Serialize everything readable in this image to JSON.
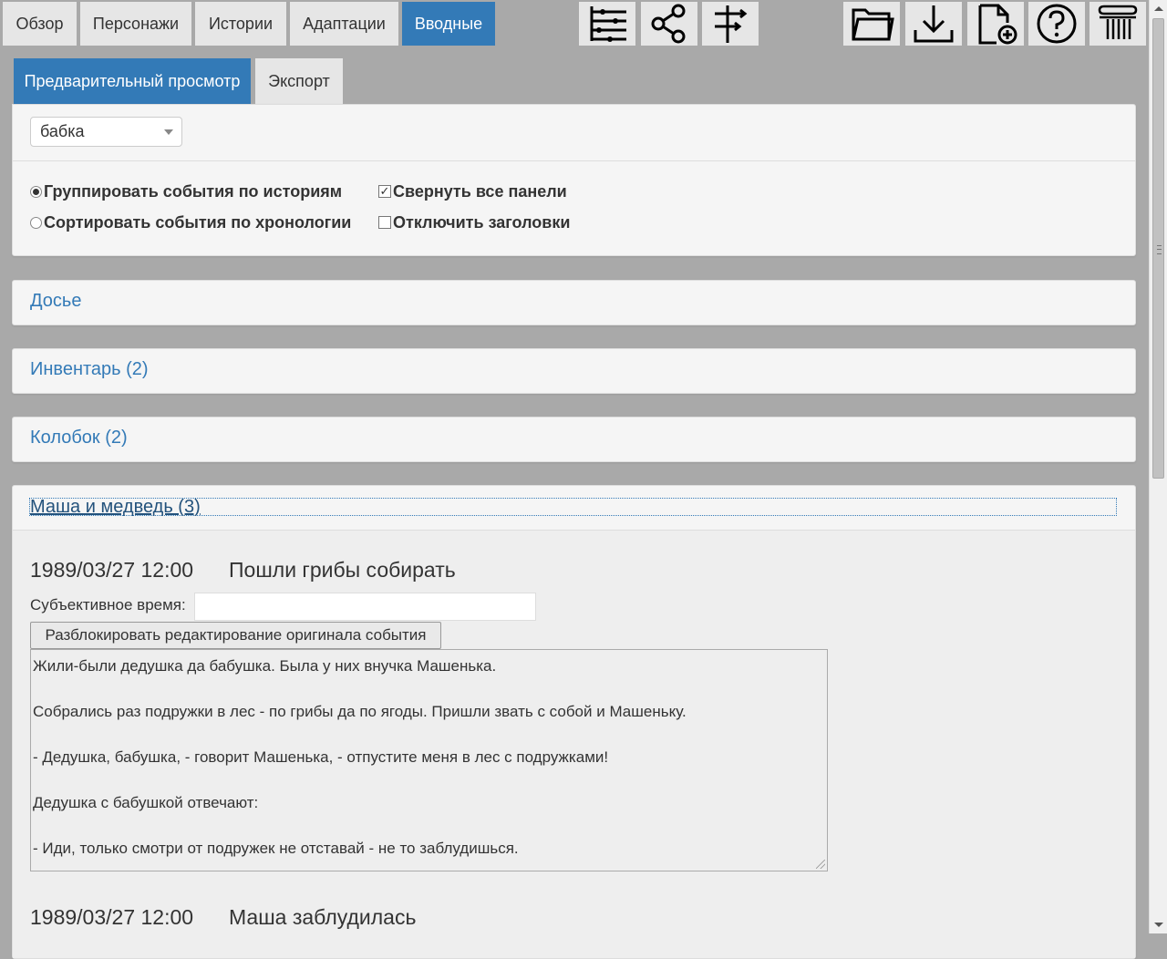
{
  "nav": {
    "tabs": [
      {
        "label": "Обзор",
        "active": false
      },
      {
        "label": "Персонажи",
        "active": false
      },
      {
        "label": "Истории",
        "active": false
      },
      {
        "label": "Адаптации",
        "active": false
      },
      {
        "label": "Вводные",
        "active": true
      }
    ],
    "tool_icons": [
      "timeline-icon",
      "network-icon",
      "signpost-icon"
    ],
    "action_icons": [
      "open-folder-icon",
      "download-icon",
      "new-file-icon",
      "help-icon",
      "column-icon"
    ]
  },
  "subtabs": [
    {
      "label": "Предварительный просмотр",
      "active": true
    },
    {
      "label": "Экспорт",
      "active": false
    }
  ],
  "settings": {
    "character_select": "бабка",
    "group_by_story": "Группировать события по историям",
    "sort_chronology": "Сортировать события по хронологии",
    "collapse_all": "Свернуть все панели",
    "disable_headers": "Отключить заголовки",
    "group_by_story_checked": true,
    "collapse_all_checked": true,
    "disable_headers_checked": false
  },
  "panels": {
    "dossier": "Досье",
    "inventory": "Инвентарь (2)",
    "kolobok": "Колобок (2)",
    "masha": "Маша и медведь (3)"
  },
  "events": [
    {
      "date": "1989/03/27 12:00",
      "title": "Пошли грибы собирать",
      "subjective_label": "Субъективное время:",
      "subjective_value": "",
      "unlock_label": "Разблокировать редактирование оригинала события",
      "text": [
        "Жили-были дедушка да бабушка. Была у них внучка Машенька.",
        "Собрались раз подружки в лес - по грибы да по ягоды. Пришли звать с собой и Машеньку.",
        "- Дедушка, бабушка, - говорит Машенька, - отпустите меня в лес с подружками!",
        "Дедушка с бабушкой отвечают:",
        "- Иди, только смотри от подружек не отставай - не то заблудишься."
      ]
    },
    {
      "date": "1989/03/27 12:00",
      "title": "Маша заблудилась"
    }
  ],
  "colors": {
    "accent": "#337ab7",
    "link": "#337ab7",
    "background": "#a9a9a9"
  }
}
